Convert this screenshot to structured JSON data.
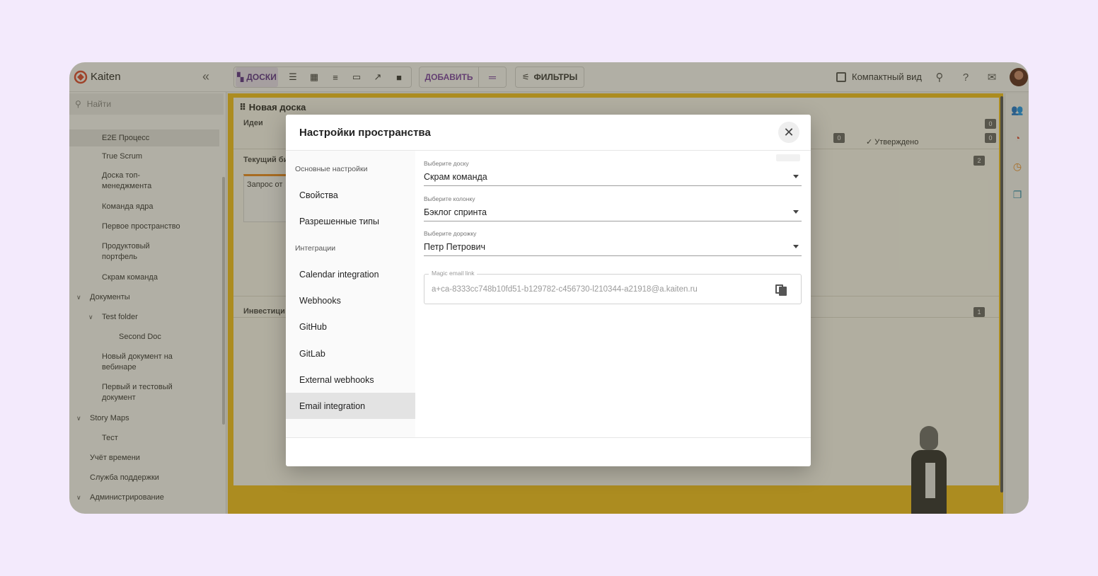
{
  "app": {
    "name": "Kaiten",
    "collapse_icon": "double-chevron-left-icon",
    "search_placeholder": "Найти",
    "toolbar": {
      "boards_label": "ДОСКИ",
      "add_label": "ДОБАВИТЬ",
      "filters_label": "ФИЛЬТРЫ",
      "compact_view_label": "Компактный вид"
    },
    "sidebar": {
      "items": [
        {
          "label": "E2E Процесс"
        },
        {
          "label": "True Scrum"
        },
        {
          "label": "Доска топ-менеджмента"
        },
        {
          "label": "Команда ядра"
        },
        {
          "label": "Первое пространство"
        },
        {
          "label": "Продуктовый портфель"
        },
        {
          "label": "Скрам команда"
        },
        {
          "label": "Документы"
        },
        {
          "label": "Test folder"
        },
        {
          "label": "Second Doc"
        },
        {
          "label": "Новый документ на вебинаре"
        },
        {
          "label": "Первый и тестовый документ"
        },
        {
          "label": "Story Maps"
        },
        {
          "label": "Тест"
        },
        {
          "label": "Учёт времени"
        },
        {
          "label": "Служба поддержки"
        },
        {
          "label": "Администрирование"
        }
      ]
    },
    "board": {
      "title": "Новая доска",
      "lane_ideas": "Идеи",
      "lane_current": "Текущий би",
      "lane_invest": "Инвестици",
      "card_text": "Запрос от",
      "approved_label": "✓ Утверждено",
      "badges": [
        "0",
        "0",
        "0",
        "2",
        "1"
      ]
    },
    "accent_color": "#7b3fa8",
    "board_color": "#f7c31a"
  },
  "modal": {
    "title": "Настройки пространства",
    "close_icon": "close-icon",
    "nav": {
      "section_main": "Основные настройки",
      "properties": "Свойства",
      "allowed_types": "Разрешенные типы",
      "section_integrations": "Интеграции",
      "calendar": "Calendar integration",
      "webhooks": "Webhooks",
      "github": "GitHub",
      "gitlab": "GitLab",
      "external_webhooks": "External webhooks",
      "email": "Email integration"
    },
    "form": {
      "board_label": "Выберите доску",
      "board_value": "Скрам команда",
      "column_label": "Выберите колонку",
      "column_value": "Бэклог спринта",
      "lane_label": "Выберите дорожку",
      "lane_value": "Петр Петрович",
      "magic_label": "Magic email link",
      "magic_value": "a+ca-8333cc748b10fd51-b129782-c456730-l210344-a21918@a.kaiten.ru",
      "copy_icon": "copy-icon"
    }
  }
}
